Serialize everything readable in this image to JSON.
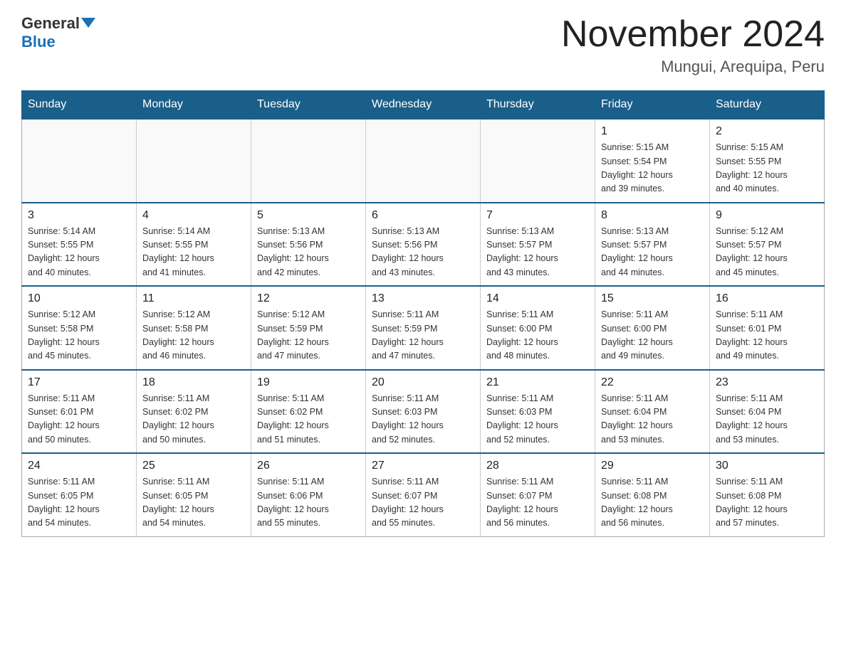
{
  "header": {
    "logo_line1": "General",
    "logo_line2": "Blue",
    "title": "November 2024",
    "subtitle": "Mungui, Arequipa, Peru"
  },
  "days_of_week": [
    "Sunday",
    "Monday",
    "Tuesday",
    "Wednesday",
    "Thursday",
    "Friday",
    "Saturday"
  ],
  "weeks": [
    [
      {
        "day": "",
        "info": ""
      },
      {
        "day": "",
        "info": ""
      },
      {
        "day": "",
        "info": ""
      },
      {
        "day": "",
        "info": ""
      },
      {
        "day": "",
        "info": ""
      },
      {
        "day": "1",
        "info": "Sunrise: 5:15 AM\nSunset: 5:54 PM\nDaylight: 12 hours\nand 39 minutes."
      },
      {
        "day": "2",
        "info": "Sunrise: 5:15 AM\nSunset: 5:55 PM\nDaylight: 12 hours\nand 40 minutes."
      }
    ],
    [
      {
        "day": "3",
        "info": "Sunrise: 5:14 AM\nSunset: 5:55 PM\nDaylight: 12 hours\nand 40 minutes."
      },
      {
        "day": "4",
        "info": "Sunrise: 5:14 AM\nSunset: 5:55 PM\nDaylight: 12 hours\nand 41 minutes."
      },
      {
        "day": "5",
        "info": "Sunrise: 5:13 AM\nSunset: 5:56 PM\nDaylight: 12 hours\nand 42 minutes."
      },
      {
        "day": "6",
        "info": "Sunrise: 5:13 AM\nSunset: 5:56 PM\nDaylight: 12 hours\nand 43 minutes."
      },
      {
        "day": "7",
        "info": "Sunrise: 5:13 AM\nSunset: 5:57 PM\nDaylight: 12 hours\nand 43 minutes."
      },
      {
        "day": "8",
        "info": "Sunrise: 5:13 AM\nSunset: 5:57 PM\nDaylight: 12 hours\nand 44 minutes."
      },
      {
        "day": "9",
        "info": "Sunrise: 5:12 AM\nSunset: 5:57 PM\nDaylight: 12 hours\nand 45 minutes."
      }
    ],
    [
      {
        "day": "10",
        "info": "Sunrise: 5:12 AM\nSunset: 5:58 PM\nDaylight: 12 hours\nand 45 minutes."
      },
      {
        "day": "11",
        "info": "Sunrise: 5:12 AM\nSunset: 5:58 PM\nDaylight: 12 hours\nand 46 minutes."
      },
      {
        "day": "12",
        "info": "Sunrise: 5:12 AM\nSunset: 5:59 PM\nDaylight: 12 hours\nand 47 minutes."
      },
      {
        "day": "13",
        "info": "Sunrise: 5:11 AM\nSunset: 5:59 PM\nDaylight: 12 hours\nand 47 minutes."
      },
      {
        "day": "14",
        "info": "Sunrise: 5:11 AM\nSunset: 6:00 PM\nDaylight: 12 hours\nand 48 minutes."
      },
      {
        "day": "15",
        "info": "Sunrise: 5:11 AM\nSunset: 6:00 PM\nDaylight: 12 hours\nand 49 minutes."
      },
      {
        "day": "16",
        "info": "Sunrise: 5:11 AM\nSunset: 6:01 PM\nDaylight: 12 hours\nand 49 minutes."
      }
    ],
    [
      {
        "day": "17",
        "info": "Sunrise: 5:11 AM\nSunset: 6:01 PM\nDaylight: 12 hours\nand 50 minutes."
      },
      {
        "day": "18",
        "info": "Sunrise: 5:11 AM\nSunset: 6:02 PM\nDaylight: 12 hours\nand 50 minutes."
      },
      {
        "day": "19",
        "info": "Sunrise: 5:11 AM\nSunset: 6:02 PM\nDaylight: 12 hours\nand 51 minutes."
      },
      {
        "day": "20",
        "info": "Sunrise: 5:11 AM\nSunset: 6:03 PM\nDaylight: 12 hours\nand 52 minutes."
      },
      {
        "day": "21",
        "info": "Sunrise: 5:11 AM\nSunset: 6:03 PM\nDaylight: 12 hours\nand 52 minutes."
      },
      {
        "day": "22",
        "info": "Sunrise: 5:11 AM\nSunset: 6:04 PM\nDaylight: 12 hours\nand 53 minutes."
      },
      {
        "day": "23",
        "info": "Sunrise: 5:11 AM\nSunset: 6:04 PM\nDaylight: 12 hours\nand 53 minutes."
      }
    ],
    [
      {
        "day": "24",
        "info": "Sunrise: 5:11 AM\nSunset: 6:05 PM\nDaylight: 12 hours\nand 54 minutes."
      },
      {
        "day": "25",
        "info": "Sunrise: 5:11 AM\nSunset: 6:05 PM\nDaylight: 12 hours\nand 54 minutes."
      },
      {
        "day": "26",
        "info": "Sunrise: 5:11 AM\nSunset: 6:06 PM\nDaylight: 12 hours\nand 55 minutes."
      },
      {
        "day": "27",
        "info": "Sunrise: 5:11 AM\nSunset: 6:07 PM\nDaylight: 12 hours\nand 55 minutes."
      },
      {
        "day": "28",
        "info": "Sunrise: 5:11 AM\nSunset: 6:07 PM\nDaylight: 12 hours\nand 56 minutes."
      },
      {
        "day": "29",
        "info": "Sunrise: 5:11 AM\nSunset: 6:08 PM\nDaylight: 12 hours\nand 56 minutes."
      },
      {
        "day": "30",
        "info": "Sunrise: 5:11 AM\nSunset: 6:08 PM\nDaylight: 12 hours\nand 57 minutes."
      }
    ]
  ]
}
